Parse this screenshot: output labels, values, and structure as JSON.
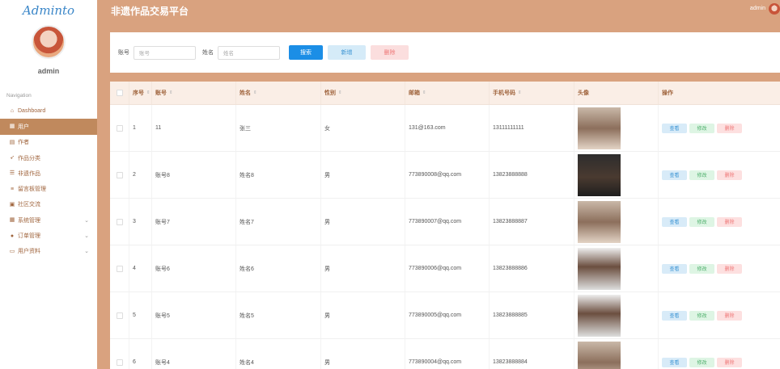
{
  "app": {
    "logo": "Adminto",
    "title": "非遗作品交易平台",
    "user": "admin"
  },
  "sidebar": {
    "username": "admin",
    "caption": "Navigation",
    "items": [
      {
        "label": "Dashboard",
        "icon": "home-icon",
        "glyph": "⌂",
        "active": false,
        "expandable": false
      },
      {
        "label": "用户",
        "icon": "grid-icon",
        "glyph": "▦",
        "active": true,
        "expandable": false
      },
      {
        "label": "作者",
        "icon": "file-icon",
        "glyph": "▤",
        "active": false,
        "expandable": false
      },
      {
        "label": "作品分类",
        "icon": "rocket-icon",
        "glyph": "➶",
        "active": false,
        "expandable": false
      },
      {
        "label": "非遗作品",
        "icon": "sliders-icon",
        "glyph": "☰",
        "active": false,
        "expandable": false
      },
      {
        "label": "留言板管理",
        "icon": "list-icon",
        "glyph": "≡",
        "active": false,
        "expandable": false
      },
      {
        "label": "社区交流",
        "icon": "briefcase-icon",
        "glyph": "▣",
        "active": false,
        "expandable": false
      },
      {
        "label": "系统管理",
        "icon": "grid-icon",
        "glyph": "▦",
        "active": false,
        "expandable": true
      },
      {
        "label": "订单管理",
        "icon": "user-icon",
        "glyph": "●",
        "active": false,
        "expandable": true
      },
      {
        "label": "用户资料",
        "icon": "window-icon",
        "glyph": "▭",
        "active": false,
        "expandable": true
      }
    ]
  },
  "search": {
    "account_label": "账号",
    "account_placeholder": "账号",
    "name_label": "姓名",
    "name_placeholder": "姓名",
    "search_btn": "搜索",
    "add_btn": "新增",
    "delete_btn": "删除"
  },
  "table": {
    "headers": [
      "",
      "序号",
      "账号",
      "姓名",
      "性别",
      "邮箱",
      "手机号码",
      "头像",
      "操作"
    ],
    "actions": {
      "view": "查看",
      "edit": "修改",
      "delete": "删除"
    },
    "rows": [
      {
        "no": "1",
        "account": "11",
        "name": "张三",
        "gender": "女",
        "email": "131@163.com",
        "phone": "13111111111"
      },
      {
        "no": "2",
        "account": "账号8",
        "name": "姓名8",
        "gender": "男",
        "email": "773890008@qq.com",
        "phone": "13823888888"
      },
      {
        "no": "3",
        "account": "账号7",
        "name": "姓名7",
        "gender": "男",
        "email": "773890007@qq.com",
        "phone": "13823888887"
      },
      {
        "no": "4",
        "account": "账号6",
        "name": "姓名6",
        "gender": "男",
        "email": "773890006@qq.com",
        "phone": "13823888886"
      },
      {
        "no": "5",
        "account": "账号5",
        "name": "姓名5",
        "gender": "男",
        "email": "773890005@qq.com",
        "phone": "13823888885"
      },
      {
        "no": "6",
        "account": "账号4",
        "name": "姓名4",
        "gender": "男",
        "email": "773890004@qq.com",
        "phone": "13823888884"
      }
    ]
  },
  "colors": {
    "header_bg": "#d9a27f",
    "active_nav": "#c0895d",
    "search_btn": "#1b8ee6"
  }
}
